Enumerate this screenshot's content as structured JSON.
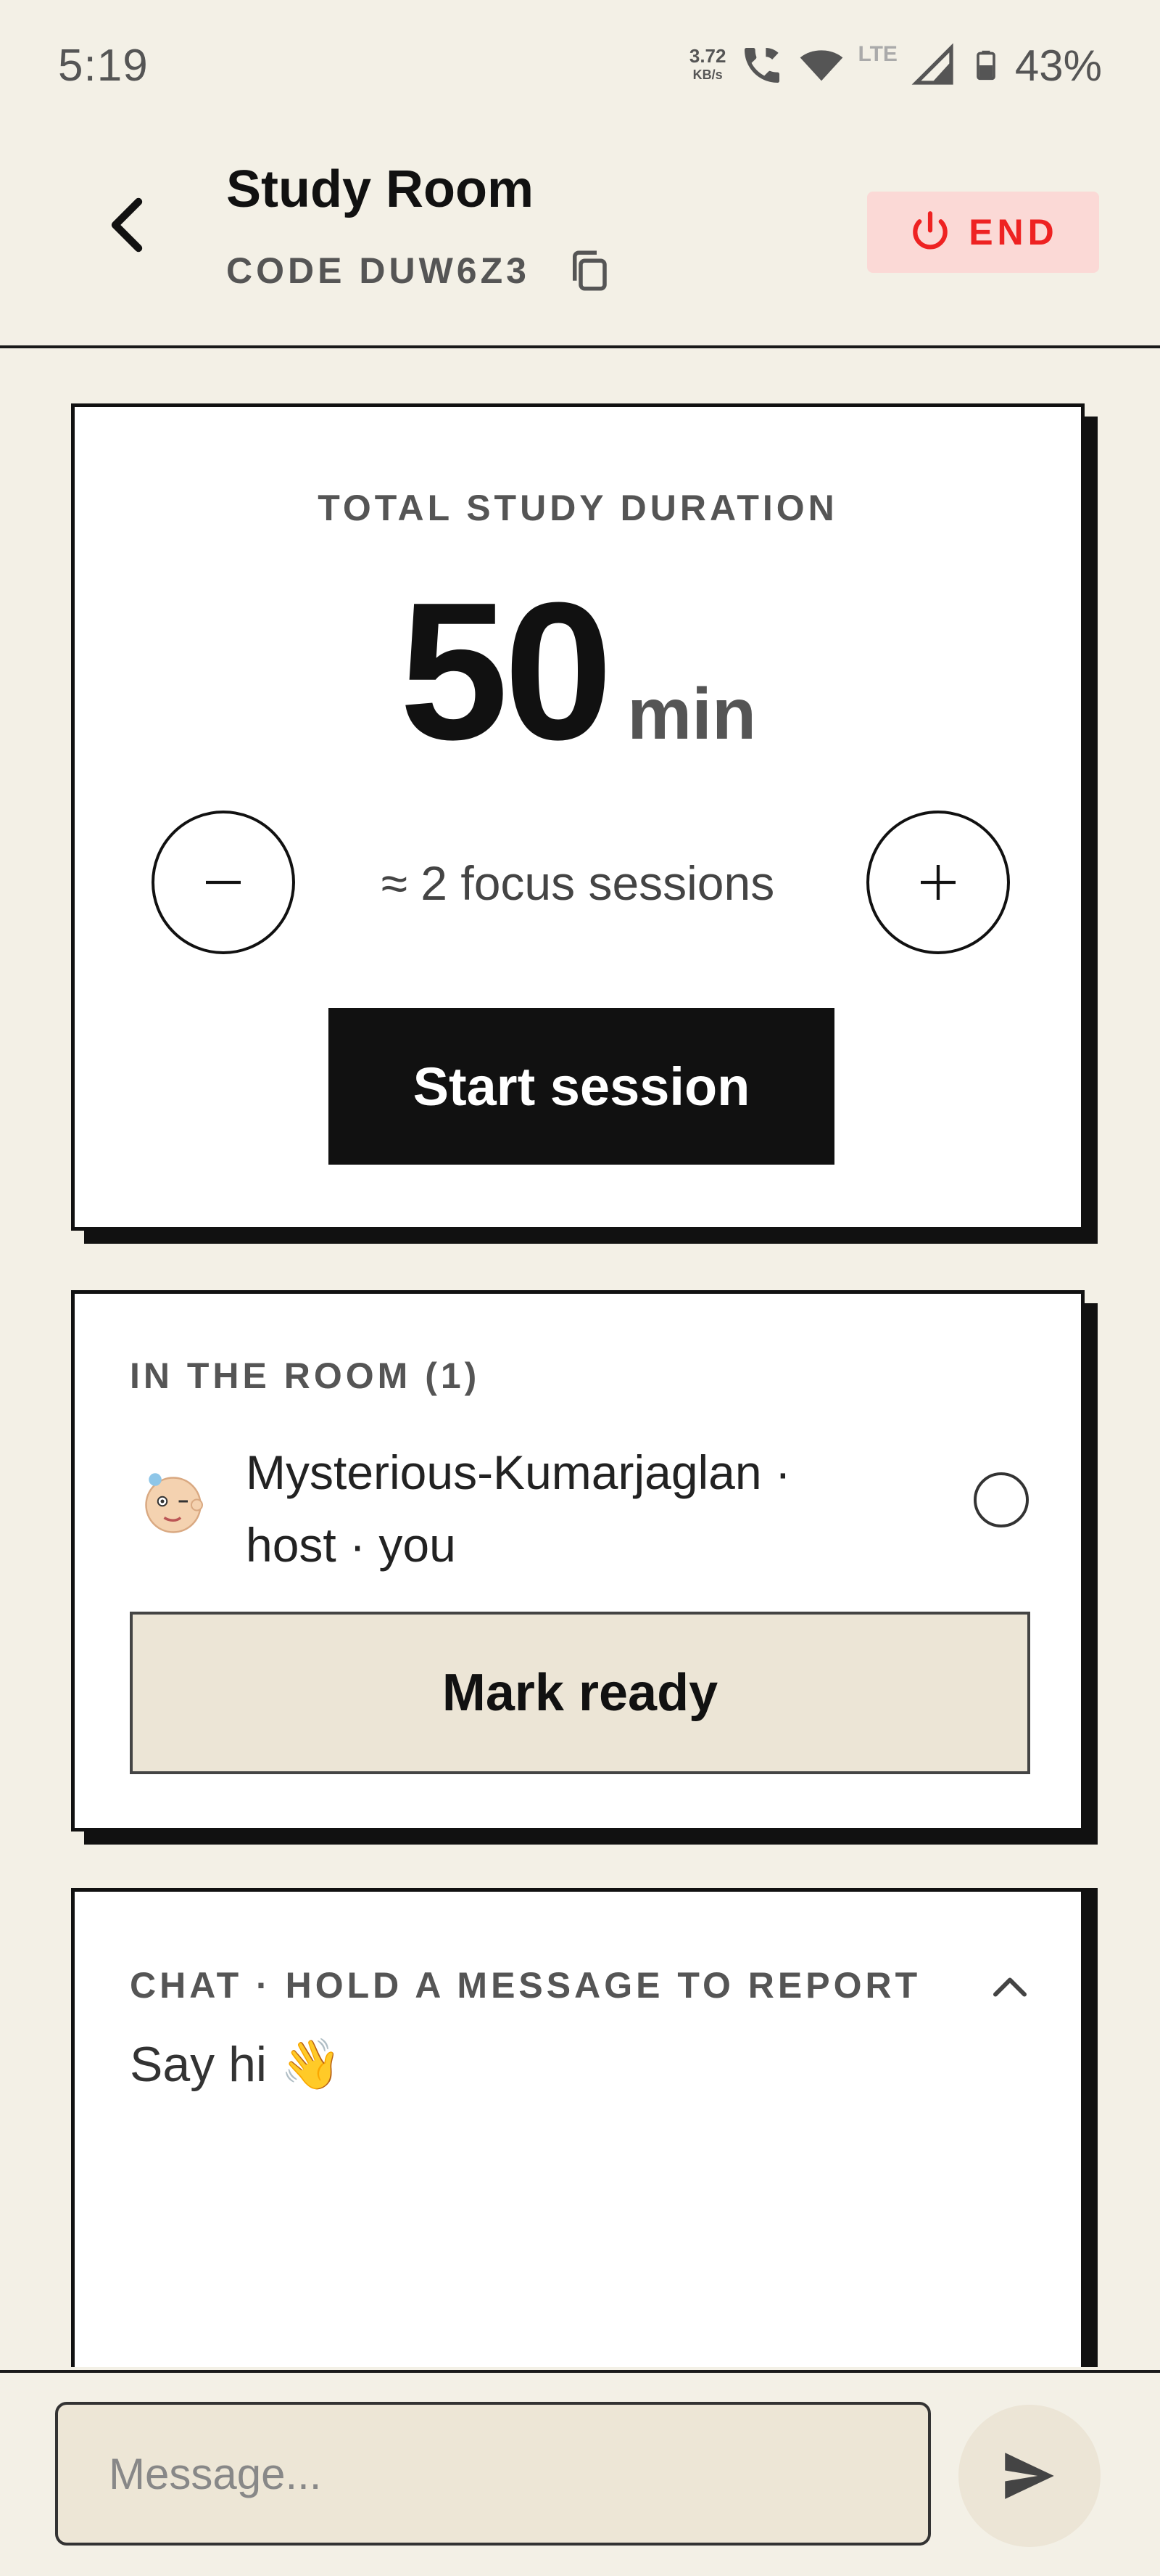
{
  "status_bar": {
    "time": "5:19",
    "net_speed_value": "3.72",
    "net_speed_unit": "KB/s",
    "network_type": "LTE",
    "battery": "43%"
  },
  "header": {
    "title": "Study Room",
    "code_label": "CODE DUW6Z3",
    "end_label": "END"
  },
  "duration": {
    "label": "TOTAL STUDY DURATION",
    "value": "50",
    "unit": "min",
    "sessions_text": "≈ 2 focus sessions",
    "start_label": "Start session"
  },
  "room": {
    "label": "IN THE ROOM (1)",
    "members": [
      {
        "name_line1": "Mysterious-Kumarjaglan  ·",
        "name_line2": "host  · you"
      }
    ],
    "mark_ready_label": "Mark ready"
  },
  "chat": {
    "label": "CHAT · HOLD A MESSAGE TO REPORT",
    "empty_text": "Say hi 👋"
  },
  "composer": {
    "placeholder": "Message..."
  },
  "colors": {
    "background": "#f3f0e6",
    "end_bg": "#fbd9d6",
    "end_text": "#e22222",
    "primary_button": "#111111",
    "secondary_button": "#ece5d6"
  },
  "icons": {
    "back": "chevron-left-icon",
    "copy": "copy-icon",
    "end": "power-icon",
    "minus": "minus-icon",
    "plus": "plus-icon",
    "collapse": "chevron-up-icon",
    "send": "send-icon"
  }
}
